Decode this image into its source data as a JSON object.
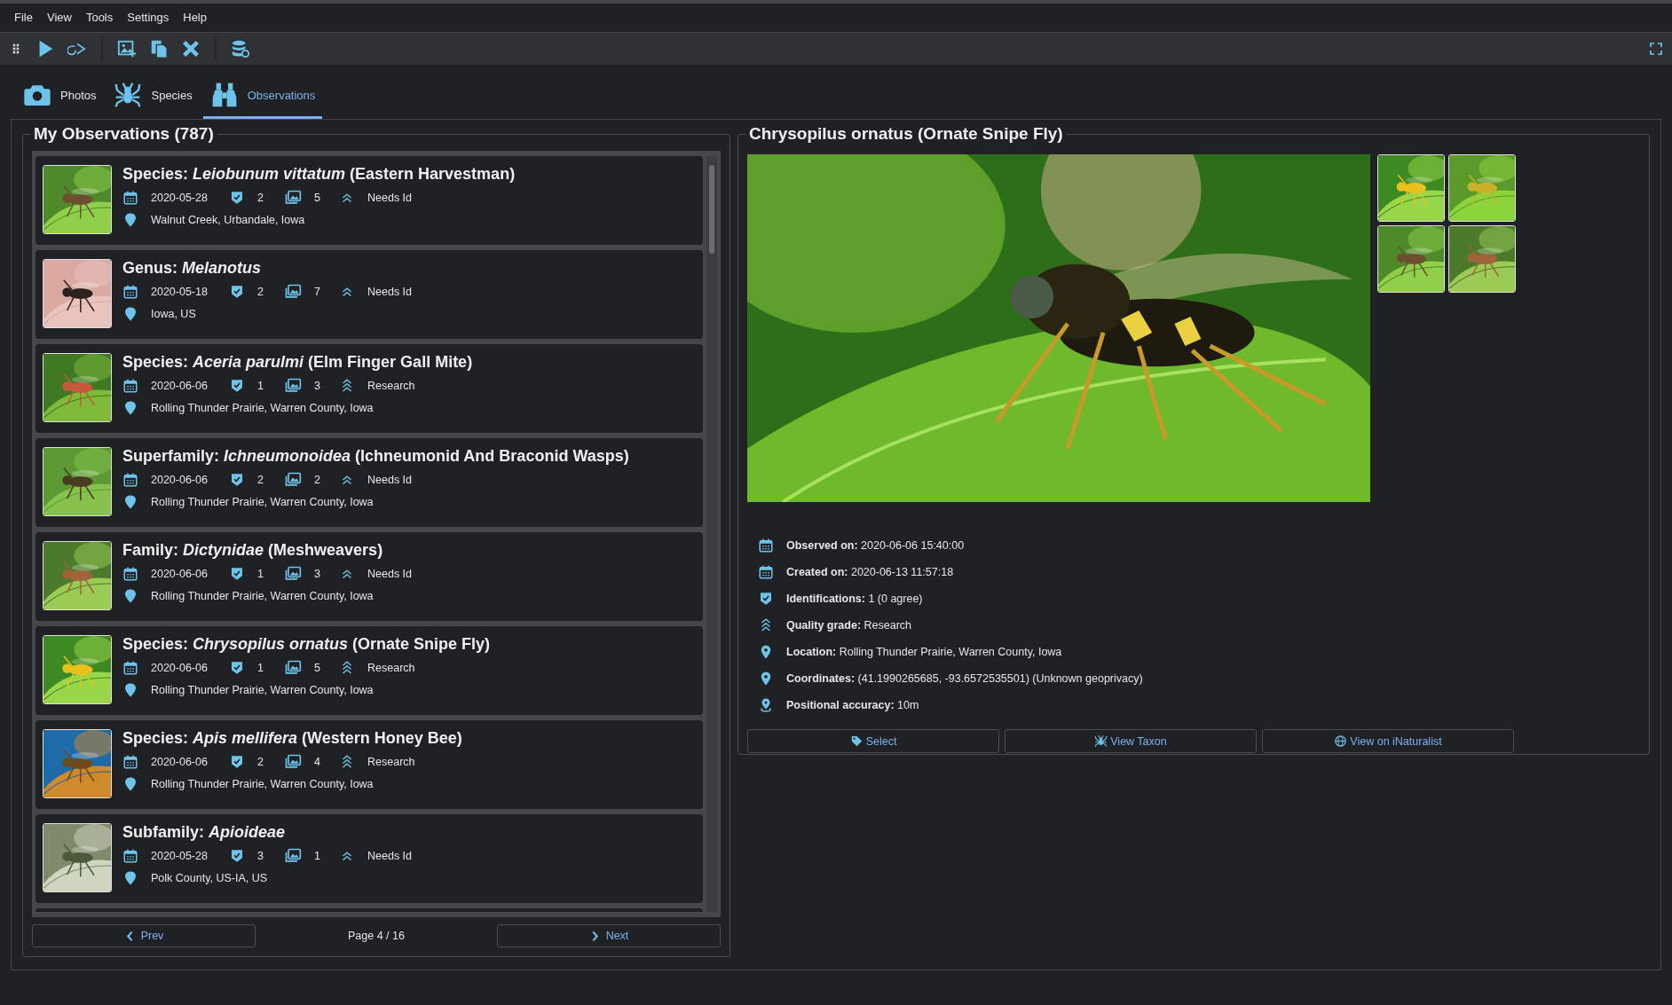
{
  "menu": [
    "File",
    "View",
    "Tools",
    "Settings",
    "Help"
  ],
  "tabs": [
    {
      "label": "Photos",
      "selected": false
    },
    {
      "label": "Species",
      "selected": false
    },
    {
      "label": "Observations",
      "selected": true
    }
  ],
  "observations": {
    "title": "My Observations (787)",
    "items": [
      {
        "title": "Species: *Leiobunum vittatum* (Eastern Harvestman)",
        "date": "2020-05-28",
        "identifications": "2",
        "photos": "5",
        "grade": "Needs Id",
        "kind": "needs_id",
        "location": "Walnut Creek, Urbandale, Iowa"
      },
      {
        "title": "Genus: *Melanotus*",
        "date": "2020-05-18",
        "identifications": "2",
        "photos": "7",
        "grade": "Needs Id",
        "kind": "needs_id",
        "location": "Iowa, US"
      },
      {
        "title": "Species: *Aceria parulmi* (Elm Finger Gall Mite)",
        "date": "2020-06-06",
        "identifications": "1",
        "photos": "3",
        "grade": "Research",
        "kind": "research",
        "location": "Rolling Thunder Prairie, Warren County, Iowa"
      },
      {
        "title": "Superfamily: *Ichneumonoidea* (Ichneumonid And Braconid Wasps)",
        "date": "2020-06-06",
        "identifications": "2",
        "photos": "2",
        "grade": "Needs Id",
        "kind": "needs_id",
        "location": "Rolling Thunder Prairie, Warren County, Iowa"
      },
      {
        "title": "Family: *Dictynidae* (Meshweavers)",
        "date": "2020-06-06",
        "identifications": "1",
        "photos": "3",
        "grade": "Needs Id",
        "kind": "needs_id",
        "location": "Rolling Thunder Prairie, Warren County, Iowa"
      },
      {
        "title": "Species: *Chrysopilus ornatus* (Ornate Snipe Fly)",
        "date": "2020-06-06",
        "identifications": "1",
        "photos": "5",
        "grade": "Research",
        "kind": "research",
        "location": "Rolling Thunder Prairie, Warren County, Iowa"
      },
      {
        "title": "Species: *Apis mellifera* (Western Honey Bee)",
        "date": "2020-06-06",
        "identifications": "2",
        "photos": "4",
        "grade": "Research",
        "kind": "research",
        "location": "Rolling Thunder Prairie, Warren County, Iowa"
      },
      {
        "title": "Subfamily: *Apioideae*",
        "date": "2020-05-28",
        "identifications": "3",
        "photos": "1",
        "grade": "Needs Id",
        "kind": "needs_id",
        "location": "Polk County, US-IA, US"
      }
    ],
    "prev": "Prev",
    "page": "Page 4 / 16",
    "next": "Next"
  },
  "detail": {
    "title": "Chrysopilus ornatus (Ornate Snipe Fly)",
    "fields": [
      {
        "label": "Observed on:",
        "value": "2020-06-06 15:40:00"
      },
      {
        "label": "Created on:",
        "value": "2020-06-13 11:57:18"
      },
      {
        "label": "Identifications:",
        "value": "1 (0 agree)"
      },
      {
        "label": "Quality grade:",
        "value": "Research"
      },
      {
        "label": "Location:",
        "value": "Rolling Thunder Prairie, Warren County, Iowa"
      },
      {
        "label": "Coordinates:",
        "value": "(41.1990265685, -93.6572535501) (Unknown geoprivacy)"
      },
      {
        "label": "Positional accuracy:",
        "value": "10m"
      }
    ],
    "buttons": [
      "Select",
      "View Taxon",
      "View on iNaturalist"
    ]
  }
}
